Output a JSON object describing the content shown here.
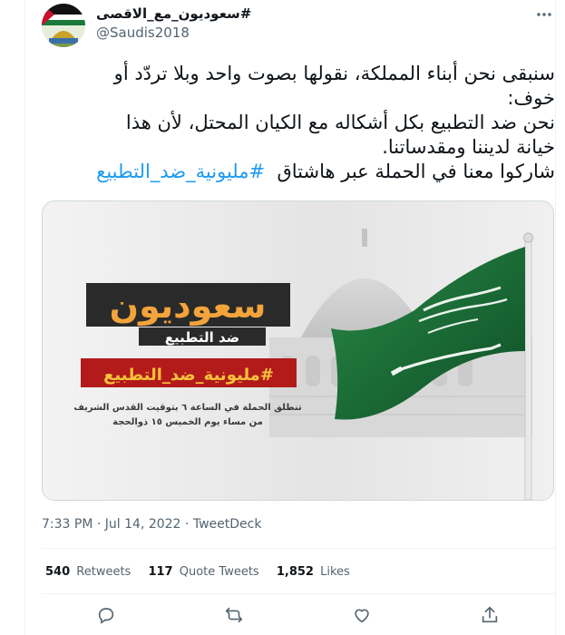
{
  "author": {
    "display_name": "#سعوديون_مع_الاقصى",
    "handle": "@Saudis2018"
  },
  "tweet": {
    "line1": "سنبقى نحن أبناء المملكة، نقولها بصوت واحد وبلا تردّد أو",
    "line2": "خوف:",
    "line3": "نحن ضد التطبيع بكل أشكاله مع الكيان المحتل، لأن هذا",
    "line4": "خيانة لديننا ومقدساتنا.",
    "line5_text": "شاركوا معنا في الحملة عبر هاشتاق",
    "line5_hashtag": "#مليونية_ضد_التطبيع"
  },
  "media": {
    "headline": "سعوديون",
    "subline": "ضد التطبيع",
    "hashtag": "#مليونية_ضد_التطبيع",
    "info_line1": "تنطلق الحملة في الساعة ٦ بتوقيت القدس الشريف",
    "info_line2": "من مساء يوم الخميس ١٥ ذوالحجة"
  },
  "meta": {
    "time": "7:33 PM",
    "date": "Jul 14, 2022",
    "source": "TweetDeck"
  },
  "stats": {
    "retweets_count": "540",
    "retweets_label": "Retweets",
    "quotes_count": "117",
    "quotes_label": "Quote Tweets",
    "likes_count": "1,852",
    "likes_label": "Likes"
  },
  "icons": [
    "more-icon",
    "reply-icon",
    "retweet-icon",
    "like-icon",
    "share-icon"
  ],
  "colors": {
    "link": "#1d9bf0",
    "secondary_text": "#536471",
    "flag_green": "#1b6b36",
    "headline_orange": "#f2a43a",
    "hashtag_red": "#b31b1b"
  }
}
